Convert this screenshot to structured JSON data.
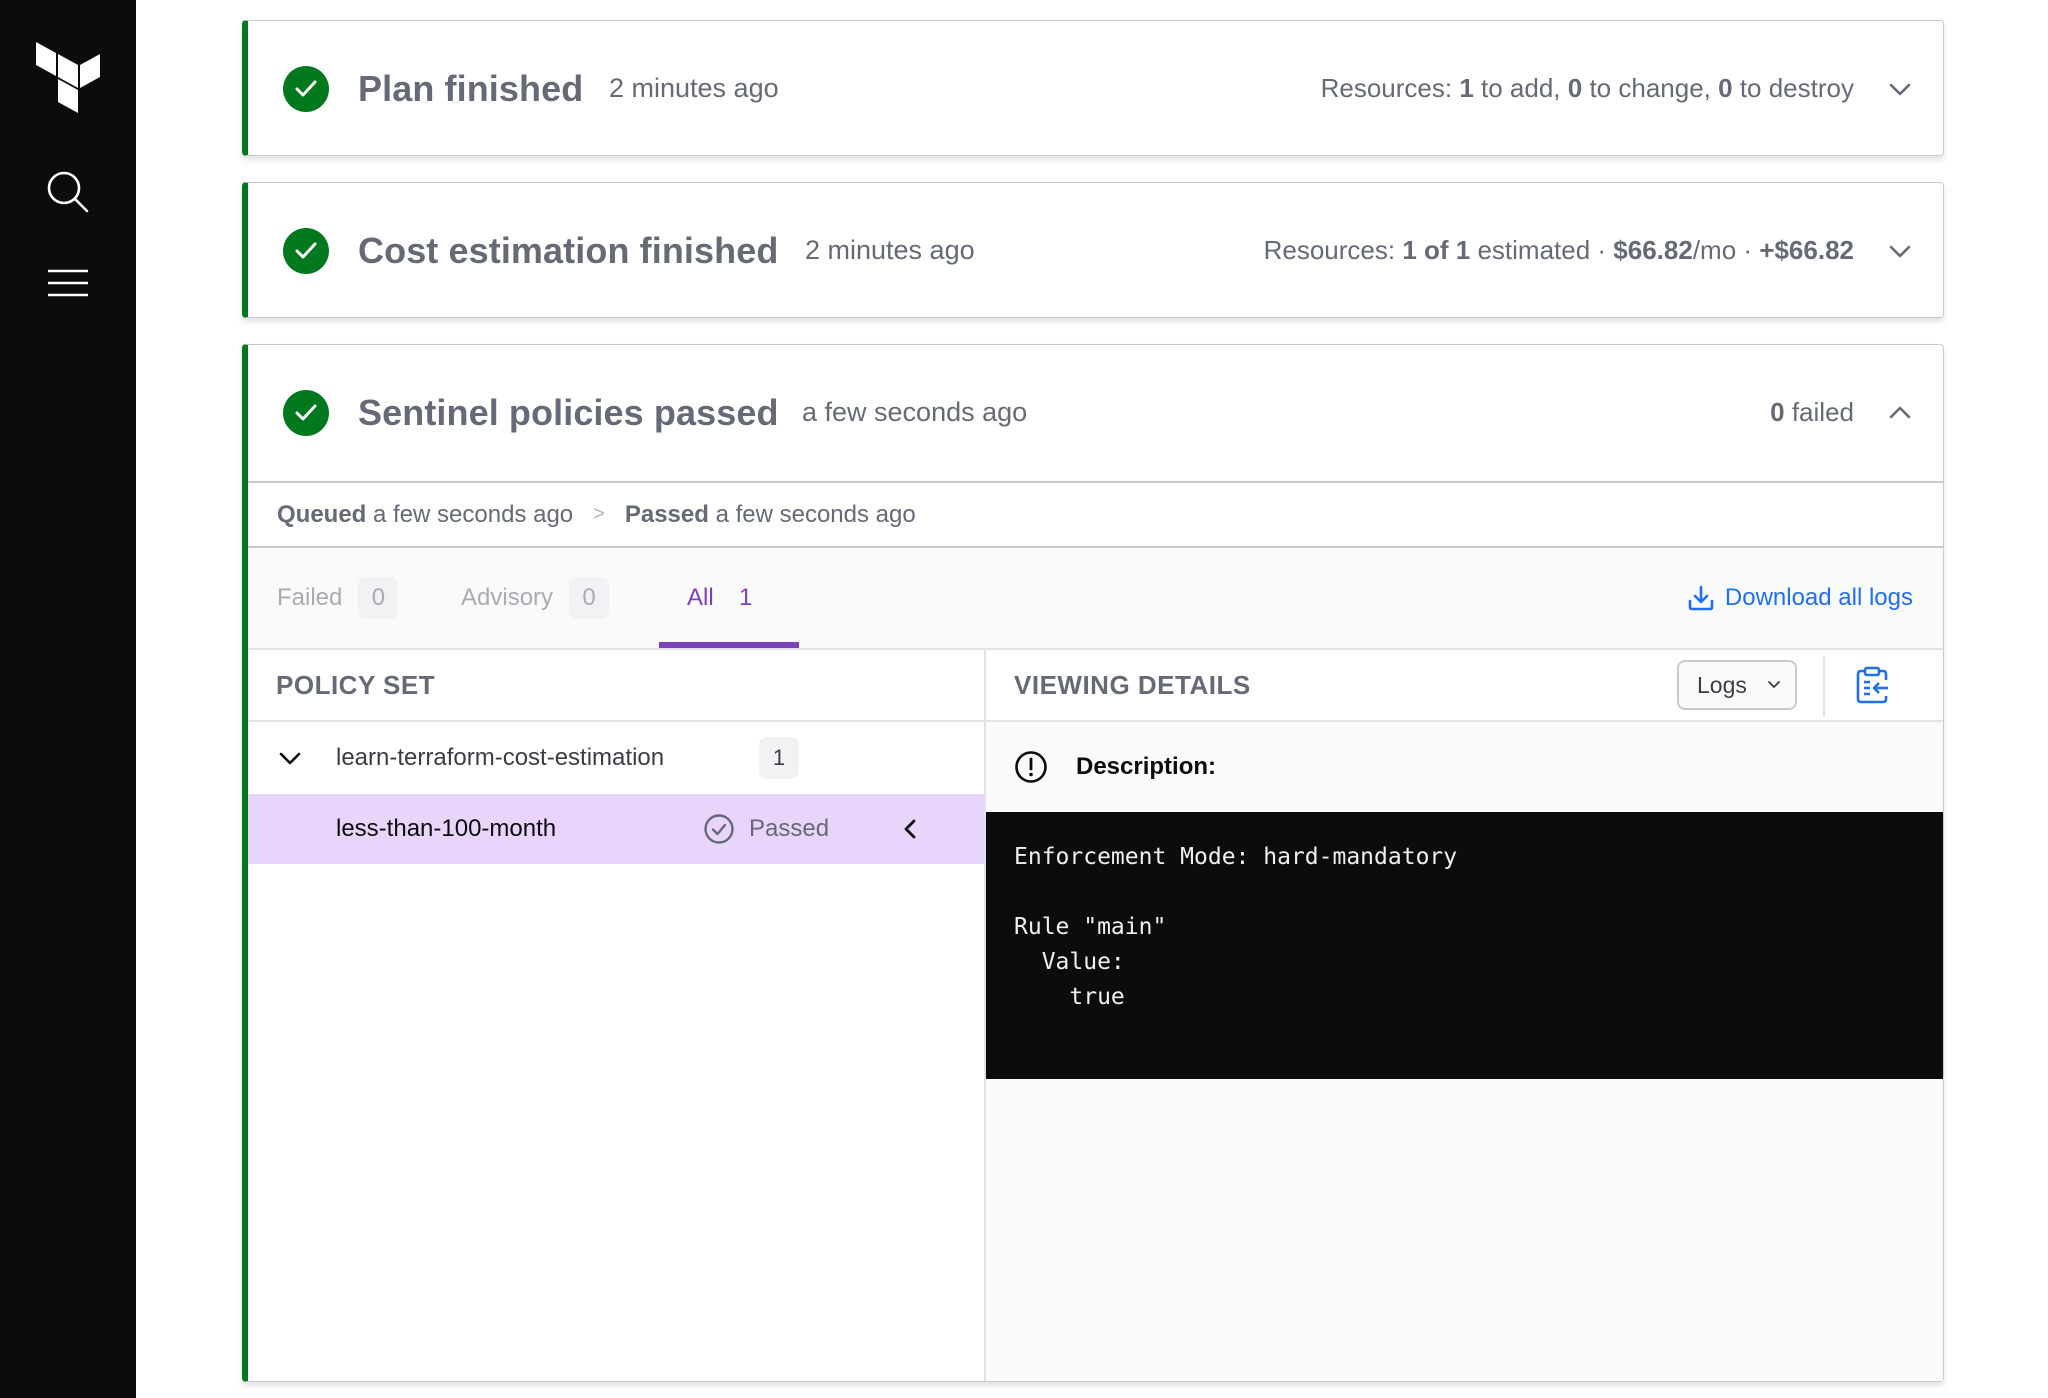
{
  "sidebar": {
    "logo": "terraform-logo",
    "icons": [
      "search-icon",
      "menu-icon"
    ]
  },
  "runs": [
    {
      "title": "Plan finished",
      "time": "2 minutes ago",
      "status_icon": "check-circle-icon",
      "summary": {
        "prefix": "Resources: ",
        "add_count": "1",
        "add_label": " to add, ",
        "change_count": "0",
        "change_label": " to change, ",
        "destroy_count": "0",
        "destroy_label": " to destroy"
      },
      "expanded": false
    },
    {
      "title": "Cost estimation finished",
      "time": "2 minutes ago",
      "status_icon": "check-circle-icon",
      "summary": {
        "prefix": "Resources: ",
        "estimated": "1 of 1",
        "estimated_label": " estimated · ",
        "monthly": "$66.82",
        "monthly_suffix": "/mo · ",
        "delta": "+$66.82"
      },
      "expanded": false
    },
    {
      "title": "Sentinel policies passed",
      "time": "a few seconds ago",
      "status_icon": "check-circle-icon",
      "summary": {
        "failed_count": "0",
        "failed_label": " failed"
      },
      "expanded": true
    }
  ],
  "sentinel": {
    "timeline": [
      {
        "state": "Queued",
        "time": " a few seconds ago"
      },
      {
        "state": "Passed",
        "time": " a few seconds ago"
      }
    ],
    "timeline_separator": ">",
    "tabs": [
      {
        "label": "Failed",
        "count": "0",
        "active": false
      },
      {
        "label": "Advisory",
        "count": "0",
        "active": false
      },
      {
        "label": "All",
        "count": "1",
        "active": true
      }
    ],
    "download_label": "Download all logs",
    "policy_set_header": "POLICY SET",
    "policy_sets": [
      {
        "name": "learn-terraform-cost-estimation",
        "count": "1",
        "policies": [
          {
            "name": "less-than-100-month",
            "status": "Passed",
            "selected": true
          }
        ]
      }
    ],
    "details_header": "VIEWING DETAILS",
    "view_select": {
      "value": "Logs"
    },
    "description_label": "Description:",
    "log_text": "Enforcement Mode: hard-mandatory\n\nRule \"main\"\n  Value:\n    true"
  },
  "colors": {
    "success": "#00781e",
    "accent_purple": "#7b42bc",
    "selected_row": "#e9d5fc",
    "link_blue": "#1f6ff0",
    "sidebar_bg": "#0c0c0e"
  }
}
